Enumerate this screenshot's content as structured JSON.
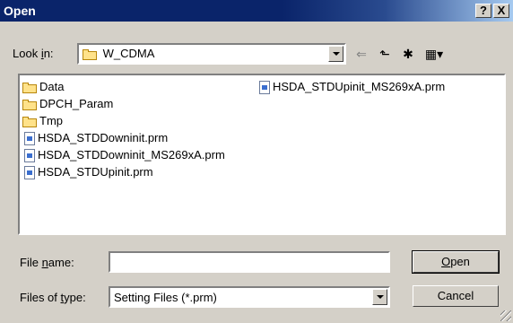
{
  "dialog": {
    "title": "Open",
    "help_label": "?",
    "close_label": "X"
  },
  "look_in": {
    "label_prefix": "Look ",
    "label_accel": "i",
    "label_suffix": "n:",
    "value": "W_CDMA"
  },
  "toolbar": {
    "back_glyph": "⇐",
    "up_glyph": "⬑",
    "new_folder_glyph": "✱",
    "view_glyph": "▦▾"
  },
  "files": {
    "col1": [
      {
        "type": "folder",
        "name": "Data"
      },
      {
        "type": "folder",
        "name": "DPCH_Param"
      },
      {
        "type": "folder",
        "name": "Tmp"
      },
      {
        "type": "file",
        "name": "HSDA_STDDowninit.prm"
      },
      {
        "type": "file",
        "name": "HSDA_STDDowninit_MS269xA.prm"
      },
      {
        "type": "file",
        "name": "HSDA_STDUpinit.prm"
      }
    ],
    "col2": [
      {
        "type": "file",
        "name": "HSDA_STDUpinit_MS269xA.prm"
      }
    ]
  },
  "file_name": {
    "label_prefix": "File ",
    "label_accel": "n",
    "label_suffix": "ame:",
    "value": ""
  },
  "file_type": {
    "label_prefix": "Files of ",
    "label_accel": "t",
    "label_suffix": "ype:",
    "value": "Setting Files (*.prm)"
  },
  "buttons": {
    "open_accel": "O",
    "open_rest": "pen",
    "cancel": "Cancel"
  }
}
